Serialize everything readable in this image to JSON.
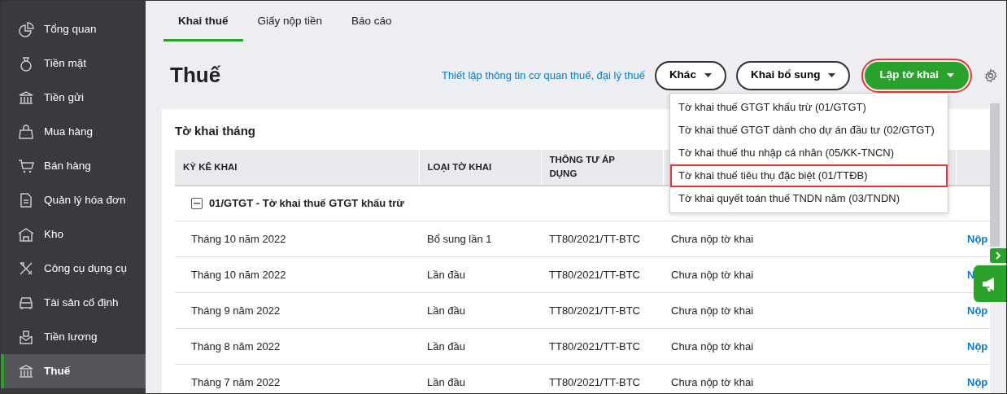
{
  "sidebar": {
    "items": [
      {
        "label": "Tổng quan",
        "selected": false
      },
      {
        "label": "Tiền mặt",
        "selected": false
      },
      {
        "label": "Tiền gửi",
        "selected": false
      },
      {
        "label": "Mua hàng",
        "selected": false
      },
      {
        "label": "Bán hàng",
        "selected": false
      },
      {
        "label": "Quản lý hóa đơn",
        "selected": false
      },
      {
        "label": "Kho",
        "selected": false
      },
      {
        "label": "Công cụ dụng cụ",
        "selected": false
      },
      {
        "label": "Tài sản cố định",
        "selected": false
      },
      {
        "label": "Tiền lương",
        "selected": false
      },
      {
        "label": "Thuế",
        "selected": true
      }
    ]
  },
  "tabs": [
    {
      "label": "Khai thuế",
      "selected": true
    },
    {
      "label": "Giấy nộp tiền",
      "selected": false
    },
    {
      "label": "Báo cáo",
      "selected": false
    }
  ],
  "header": {
    "title": "Thuế",
    "setup_link": "Thiết lập thông tin cơ quan thuế, đại lý thuế",
    "buttons": [
      {
        "label": "Khác",
        "kind": "outline",
        "highlighted": false
      },
      {
        "label": "Khai bổ sung",
        "kind": "outline",
        "highlighted": false
      },
      {
        "label": "Lập tờ khai",
        "kind": "primary",
        "highlighted": true
      }
    ]
  },
  "dropdown": {
    "items": [
      {
        "label": "Tờ khai thuế GTGT khấu trừ (01/GTGT)",
        "highlighted": false
      },
      {
        "label": "Tờ khai thuế GTGT dành cho dự án đầu tư (02/GTGT)",
        "highlighted": false
      },
      {
        "label": "Tờ khai thuế thu nhập cá nhân (05/KK-TNCN)",
        "highlighted": false
      },
      {
        "label": "Tờ khai thuế tiêu thụ đặc biệt (01/TTĐB)",
        "highlighted": true
      },
      {
        "label": "Tờ khai quyết toán thuế TNDN năm (03/TNDN)",
        "highlighted": false
      }
    ]
  },
  "card": {
    "title": "Tờ khai tháng",
    "table": {
      "columns": [
        "KỲ KÊ KHAI",
        "LOẠI TỜ KHAI",
        "THÔNG TƯ ÁP DỤNG"
      ],
      "group": {
        "label": "01/GTGT - Tờ khai thuế GTGT khấu trừ",
        "expanded": true
      },
      "rows": [
        [
          "Tháng 10 năm 2022",
          "Bổ sung lần 1",
          "TT80/2021/TT-BTC",
          "Chưa nộp tờ khai",
          "Nộp"
        ],
        [
          "Tháng 10 năm 2022",
          "Lần đầu",
          "TT80/2021/TT-BTC",
          "Chưa nộp tờ khai",
          "N"
        ],
        [
          "Tháng 9 năm 2022",
          "Lần đầu",
          "TT80/2021/TT-BTC",
          "Chưa nộp tờ khai",
          "Nộp"
        ],
        [
          "Tháng 8 năm 2022",
          "Lần đầu",
          "TT80/2021/TT-BTC",
          "Chưa nộp tờ khai",
          "Nộp"
        ],
        [
          "Tháng 7 năm 2022",
          "Lần đầu",
          "TT80/2021/TT-BTC",
          "Chưa nộp tờ khai",
          "Nộp"
        ]
      ]
    }
  }
}
